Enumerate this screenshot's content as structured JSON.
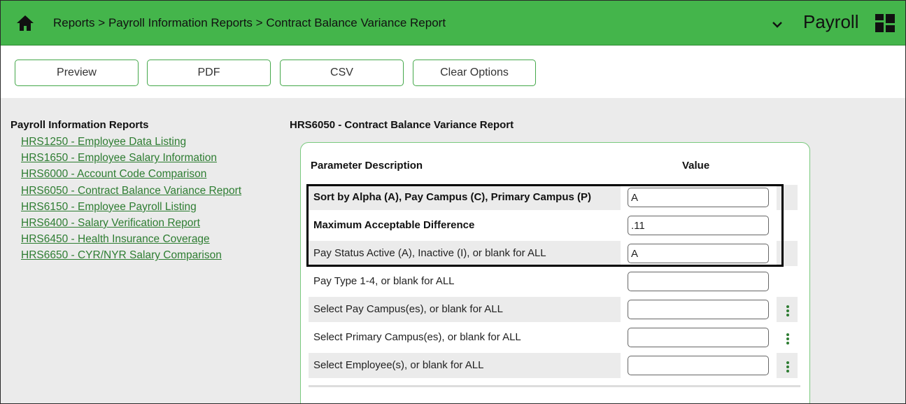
{
  "header": {
    "breadcrumb": [
      "Reports",
      ">",
      "Payroll Information Reports",
      ">",
      "Contract Balance Variance Report"
    ],
    "app_title": "Payroll",
    "colors": {
      "bar": "#44b54b",
      "accent": "#2e7d32"
    }
  },
  "toolbar": {
    "preview": "Preview",
    "pdf": "PDF",
    "csv": "CSV",
    "clear": "Clear Options"
  },
  "sidebar": {
    "title": "Payroll Information Reports",
    "links": [
      "HRS1250 - Employee Data Listing",
      "HRS1650 - Employee Salary Information",
      "HRS6000 - Account Code Comparison",
      "HRS6050 - Contract Balance Variance Report",
      "HRS6150 - Employee Payroll Listing",
      "HRS6400 - Salary Verification Report",
      "HRS6450 - Health Insurance Coverage",
      "HRS6650 - CYR/NYR Salary Comparison"
    ]
  },
  "report": {
    "title": "HRS6050 - Contract Balance Variance Report",
    "col_desc": "Parameter Description",
    "col_value": "Value",
    "params": [
      {
        "label": "Sort by Alpha (A), Pay Campus (C), Primary Campus (P)",
        "value": "A"
      },
      {
        "label": "Maximum Acceptable Difference",
        "value": ".11"
      },
      {
        "label": "Pay Status Active (A), Inactive (I), or blank for ALL",
        "value": "A"
      },
      {
        "label": "Pay Type 1-4, or blank for ALL",
        "value": ""
      },
      {
        "label": "Select Pay Campus(es), or blank for ALL",
        "value": ""
      },
      {
        "label": "Select Primary Campus(es), or blank for ALL",
        "value": ""
      },
      {
        "label": "Select Employee(s), or blank for ALL",
        "value": ""
      }
    ]
  }
}
